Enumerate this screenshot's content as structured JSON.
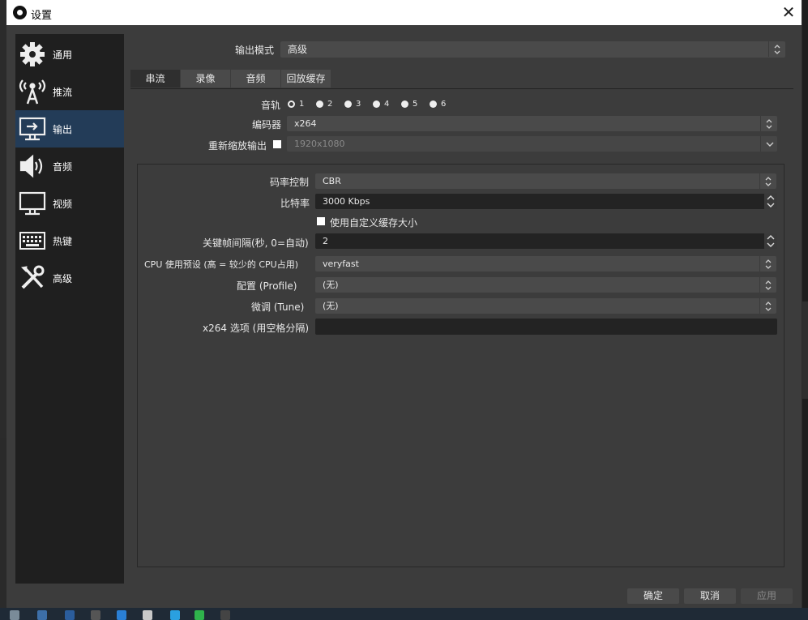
{
  "window": {
    "title": "设置",
    "close_label": "✕"
  },
  "sidebar": {
    "items": [
      {
        "label": "通用",
        "icon": "gear-icon"
      },
      {
        "label": "推流",
        "icon": "broadcast-icon"
      },
      {
        "label": "输出",
        "icon": "output-monitor-icon"
      },
      {
        "label": "音频",
        "icon": "speaker-icon"
      },
      {
        "label": "视频",
        "icon": "monitor-icon"
      },
      {
        "label": "热键",
        "icon": "keyboard-icon"
      },
      {
        "label": "高级",
        "icon": "tools-icon"
      }
    ],
    "active_index": 2
  },
  "output_mode": {
    "label": "输出模式",
    "value": "高级"
  },
  "tabs": [
    {
      "label": "串流"
    },
    {
      "label": "录像"
    },
    {
      "label": "音频"
    },
    {
      "label": "回放缓存"
    }
  ],
  "audio_track": {
    "label": "音轨",
    "options": [
      "1",
      "2",
      "3",
      "4",
      "5",
      "6"
    ],
    "selected": "1"
  },
  "encoder": {
    "label": "编码器",
    "value": "x264"
  },
  "rescale": {
    "label": "重新缩放输出",
    "checked": false,
    "value": "1920x1080"
  },
  "settings": {
    "rate_control": {
      "label": "码率控制",
      "value": "CBR"
    },
    "bitrate": {
      "label": "比特率",
      "value": "3000 Kbps"
    },
    "custom_buffer": {
      "label": "使用自定义缓存大小",
      "checked": false
    },
    "keyframe": {
      "label": "关键帧间隔(秒, 0=自动)",
      "value": "2"
    },
    "cpu_preset": {
      "label": "CPU 使用预设 (高 = 较少的 CPU占用)",
      "value": "veryfast"
    },
    "profile": {
      "label": "配置 (Profile)",
      "value": "(无)"
    },
    "tune": {
      "label": "微调 (Tune)",
      "value": "(无)"
    },
    "x264_options": {
      "label": "x264 选项 (用空格分隔)",
      "value": ""
    }
  },
  "buttons": {
    "ok": "确定",
    "cancel": "取消",
    "apply": "应用"
  }
}
